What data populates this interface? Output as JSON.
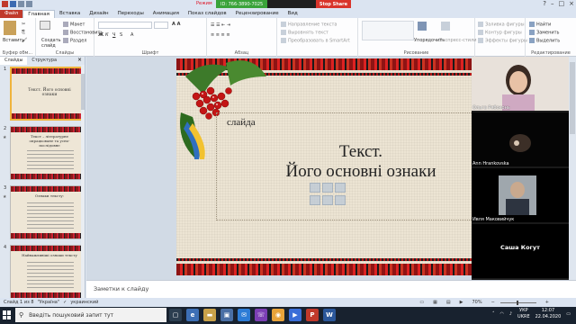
{
  "zoom_banner": {
    "label": "Режим",
    "meeting_id": "ID: 766-3890-7025",
    "stop_share": "Stop Share"
  },
  "ribbon_tabs": [
    "Файл",
    "Главная",
    "Вставка",
    "Дизайн",
    "Переходы",
    "Анимация",
    "Показ слайдов",
    "Рецензирование",
    "Вид"
  ],
  "ribbon": {
    "paste": "Вставить",
    "clipboard": "Буфер обм...",
    "new_slide": "Создать слайд",
    "layout": "Макет",
    "reset": "Восстановить",
    "section": "Раздел",
    "slides": "Слайды",
    "font": "Шрифт",
    "paragraph": "Абзац",
    "text_direction": "Направление текста",
    "align_text": "Выровнять текст",
    "smartart": "Преобразовать в SmartArt",
    "arrange": "Упорядочить",
    "quick_styles": "Экспресс-стили",
    "shape_fill": "Заливка фигуры",
    "shape_outline": "Контур фигуры",
    "shape_effects": "Эффекты фигуры",
    "drawing": "Рисование",
    "find": "Найти",
    "replace": "Заменить",
    "select": "Выделить",
    "editing": "Редактирование"
  },
  "left_panel": {
    "tab_slides": "Слайды",
    "tab_outline": "Структура",
    "close": "×"
  },
  "thumbnails": [
    {
      "num": "1",
      "text": "Текст. Його основні ознаки"
    },
    {
      "num": "2",
      "text": "Текст – літературне опрацьоване та усно-послідовне"
    },
    {
      "num": "3",
      "text": "Ознаки тексту:"
    },
    {
      "num": "4",
      "text": "Найважливіші ознаки тексту"
    }
  ],
  "slide": {
    "subtitle": "слайда",
    "title_line1": "Текст.",
    "title_line2": "Його основні ознаки"
  },
  "participants": [
    {
      "name": "Ольга Рябоконь"
    },
    {
      "name": "Ann Hrankovska"
    },
    {
      "name": "Ивля Маковийчук"
    },
    {
      "name": "Саша Когут"
    }
  ],
  "notes": {
    "placeholder": "Заметки к слайду"
  },
  "status": {
    "slide": "Слайд 1 из 8",
    "theme": "\"Україна\"",
    "language": "украинский",
    "zoom": "70%"
  },
  "taskbar": {
    "search": "Введіть пошуковий запит тут",
    "lang": "УКР",
    "lang2": "UKRE",
    "time": "12:07",
    "date": "22.04.2020"
  },
  "colors": {
    "file_tab": "#c0392b",
    "zoom_green": "#3aa33a",
    "zoom_red": "#d9342b"
  }
}
